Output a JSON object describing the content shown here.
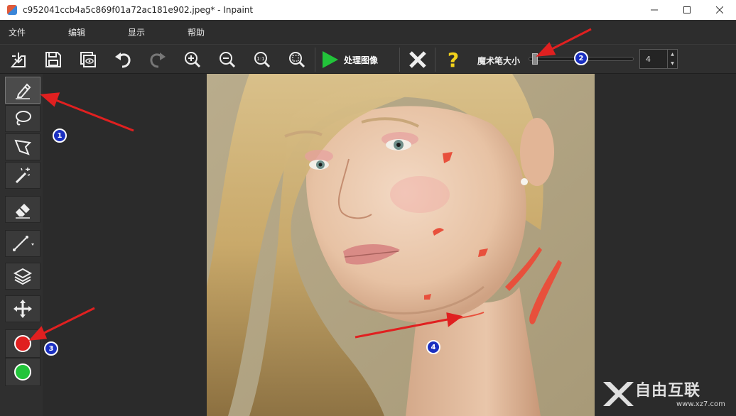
{
  "window": {
    "title": "c952041ccb4a5c869f01a72ac181e902.jpeg* - Inpaint"
  },
  "menu": {
    "items": [
      "文件",
      "编辑",
      "显示",
      "帮助"
    ]
  },
  "toolbar": {
    "process_label": "处理图像",
    "brush_size_label": "魔术笔大小",
    "brush_size_value": "4",
    "brush_size_fraction": 0.03
  },
  "annotations": {
    "badge1": "1",
    "badge2": "2",
    "badge3": "3",
    "badge4": "4"
  },
  "watermark": {
    "brand": "自由互联",
    "url": "www.xz7.com"
  },
  "colors": {
    "accent_red": "#e02020",
    "marker_green": "#22c43a",
    "mask_red": "#e8503c",
    "badge_blue": "#1a2fc0"
  }
}
